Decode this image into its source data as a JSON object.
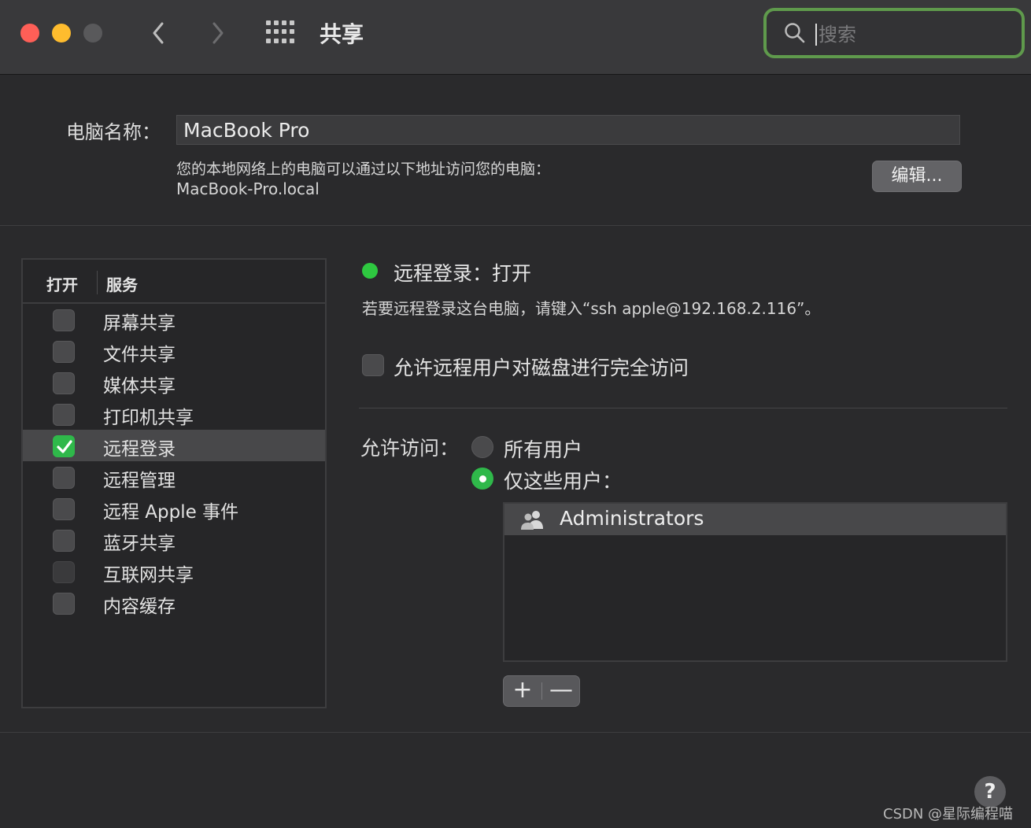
{
  "window": {
    "title": "共享",
    "search": {
      "value": "",
      "placeholder": "搜索"
    }
  },
  "computer": {
    "name_label": "电脑名称：",
    "name_value": "MacBook Pro",
    "address_note": "您的本地网络上的电脑可以通过以下地址访问您的电脑：",
    "address_value": "MacBook-Pro.local",
    "edit_label": "编辑..."
  },
  "services": {
    "header_open": "打开",
    "header_service": "服务",
    "items": [
      {
        "label": "屏幕共享",
        "checked": false
      },
      {
        "label": "文件共享",
        "checked": false
      },
      {
        "label": "媒体共享",
        "checked": false
      },
      {
        "label": "打印机共享",
        "checked": false
      },
      {
        "label": "远程登录",
        "checked": true,
        "selected": true
      },
      {
        "label": "远程管理",
        "checked": false
      },
      {
        "label": "远程 Apple 事件",
        "checked": false
      },
      {
        "label": "蓝牙共享",
        "checked": false
      },
      {
        "label": "互联网共享",
        "checked": false,
        "disabled": true
      },
      {
        "label": "内容缓存",
        "checked": false
      }
    ]
  },
  "detail": {
    "status": "远程登录：打开",
    "hint": "若要远程登录这台电脑，请键入“ssh apple@192.168.2.116”。",
    "disk_access_label": "允许远程用户对磁盘进行完全访问",
    "access_label": "允许访问：",
    "radio_all": "所有用户",
    "radio_some": "仅这些用户：",
    "users": [
      "Administrators"
    ],
    "plus": "+",
    "minus": "—"
  },
  "help": "?",
  "watermark": "CSDN @星际编程喵",
  "colors": {
    "accent_green": "#2fb84a",
    "search_border": "#5f9a4c"
  }
}
